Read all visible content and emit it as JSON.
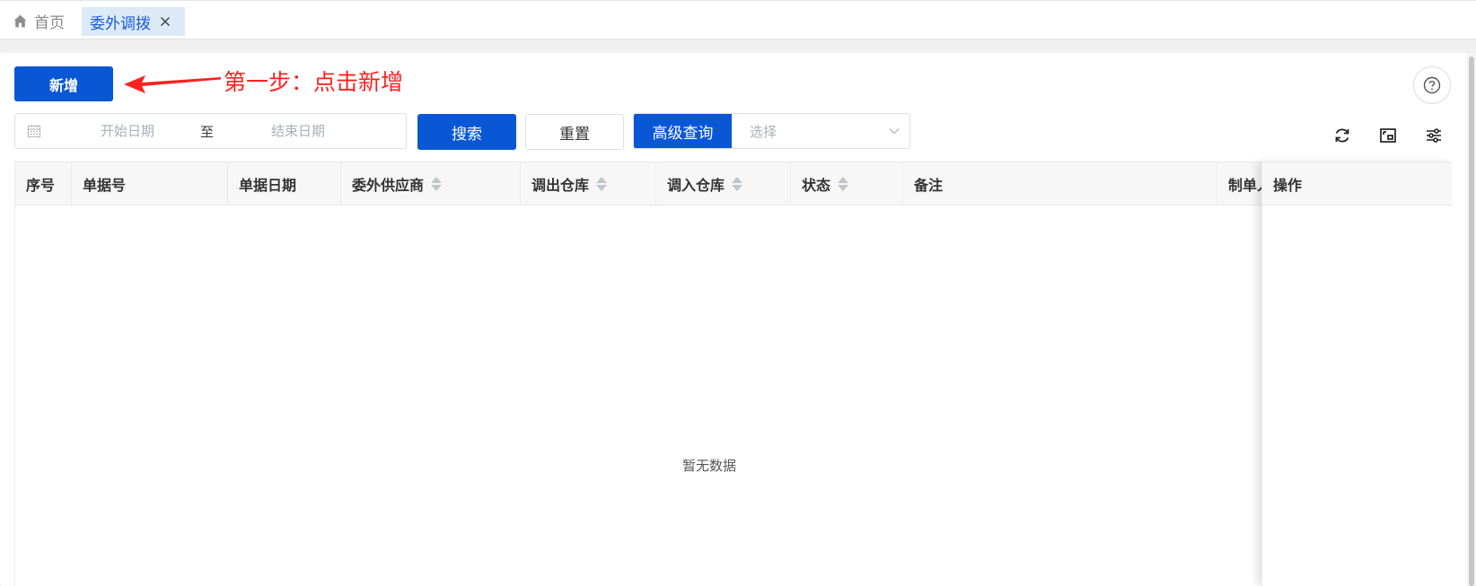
{
  "tabs": {
    "home": "首页",
    "active": "委外调拨"
  },
  "toolbar": {
    "add_label": "新增",
    "step_note": "第一步：点击新增"
  },
  "filters": {
    "start_placeholder": "开始日期",
    "separator": "至",
    "end_placeholder": "结束日期",
    "search_label": "搜索",
    "reset_label": "重置",
    "advanced_label": "高级查询",
    "select_placeholder": "选择"
  },
  "table": {
    "columns": [
      "序号",
      "单据号",
      "单据日期",
      "委外供应商",
      "调出仓库",
      "调入仓库",
      "状态",
      "备注",
      "制单人"
    ],
    "action_column": "操作",
    "empty_text": "暂无数据"
  },
  "colors": {
    "primary": "#0a57d6",
    "annotation": "#ff2020",
    "active_tab_bg": "#dceaf8"
  },
  "icons": [
    "home-icon",
    "close-icon",
    "calendar-icon",
    "chevron-down-icon",
    "help-icon",
    "refresh-icon",
    "fullscreen-icon",
    "column-settings-icon"
  ]
}
